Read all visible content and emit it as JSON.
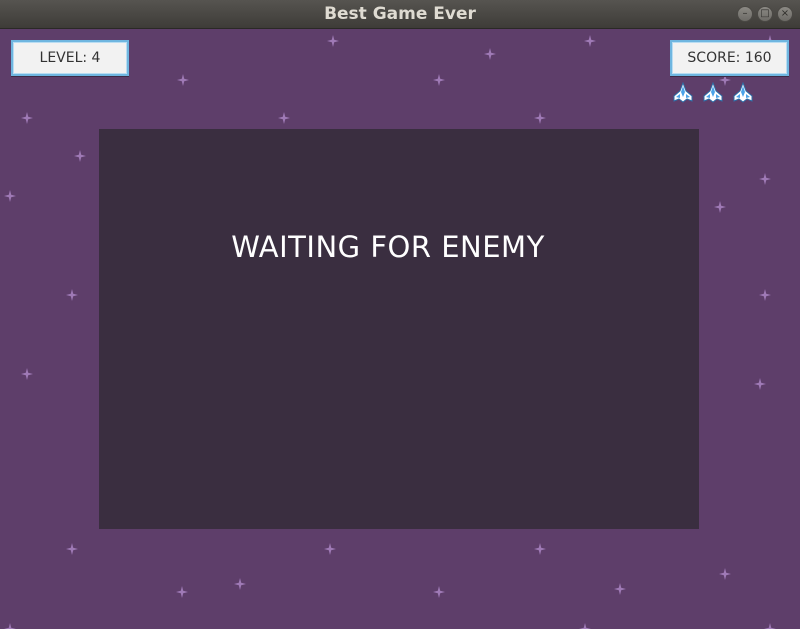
{
  "window": {
    "title": "Best Game Ever",
    "controls": [
      "minimize",
      "maximize",
      "close"
    ]
  },
  "hud": {
    "level_label": "LEVEL: 4",
    "score_label": "SCORE: 160",
    "lives": 3,
    "life_icon": "spaceship-icon"
  },
  "message": {
    "text": "WAITING FOR ENEMY"
  },
  "colors": {
    "background": "#5e3e6a",
    "panel": "#3a2e40",
    "hud_border": "#6fb6e0",
    "star": "#b58fd0",
    "ship_body": "#4aa3e8"
  }
}
